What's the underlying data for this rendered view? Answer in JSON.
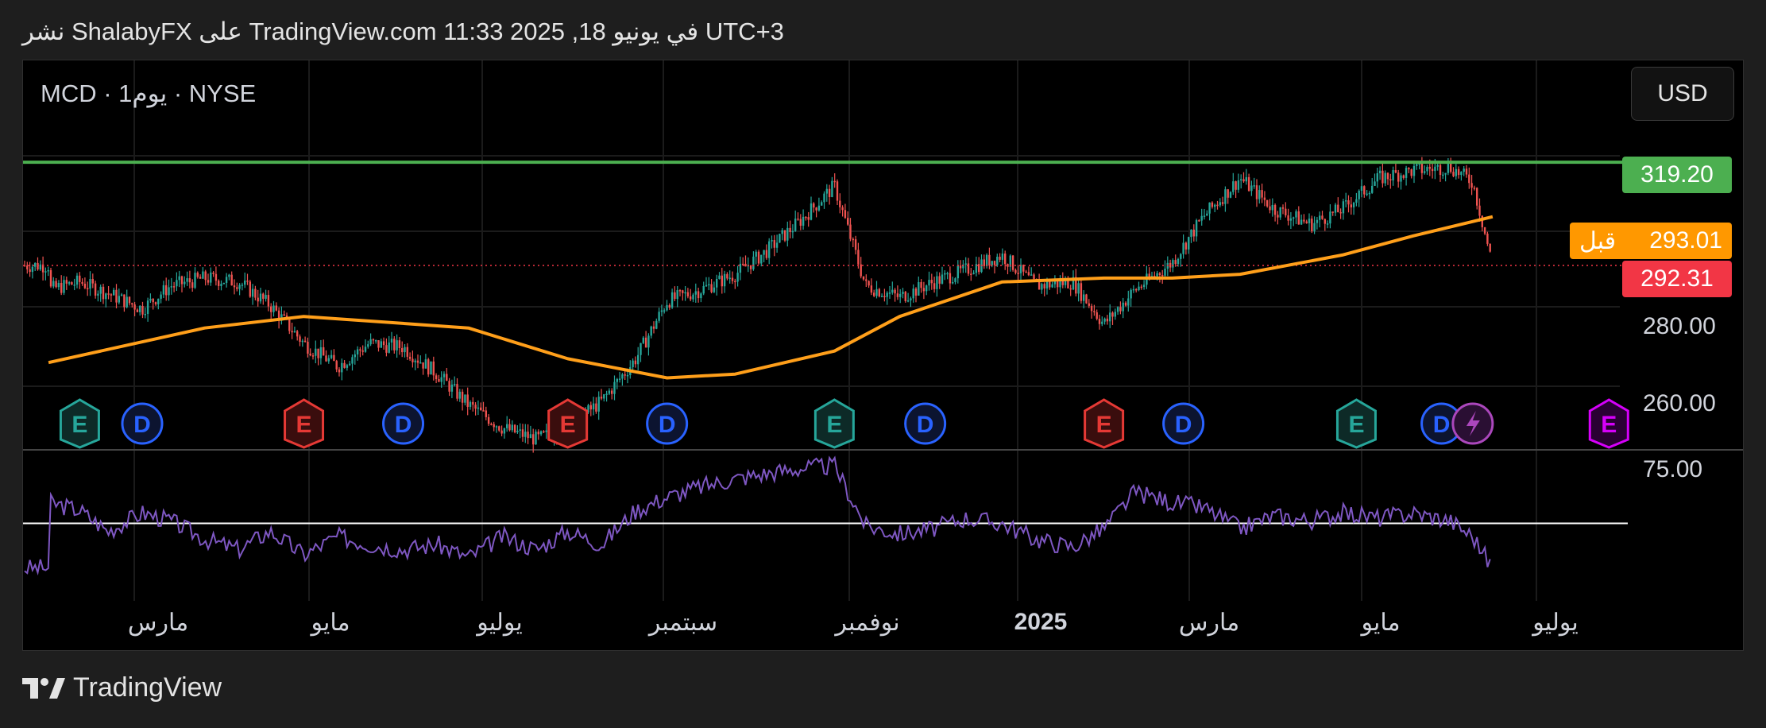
{
  "header": "نشر ShalabyFX على TradingView.com 11:33 2025 ,18 في يونيو UTC+3",
  "symbol_label": "MCD · 1يوم · NYSE",
  "currency_button": "USD",
  "price_tags": {
    "resistance": "319.20",
    "prev_label": "قبل",
    "prev_value": "293.01",
    "last_value": "292.31"
  },
  "colors": {
    "up": "#26a69a",
    "down": "#ef5350",
    "ma": "#ff9f1a",
    "resistance": "#4caf50",
    "last": "#f23645",
    "rsi": "#7e57c2"
  },
  "footer": {
    "logo_text": "TradingView"
  },
  "chart_data": {
    "type": "candlestick",
    "price_axis": {
      "ticks": [
        280,
        260
      ],
      "tick_labels": [
        "280.00",
        "260.00"
      ]
    },
    "x_axis_labels": [
      "مارس",
      "مايو",
      "يوليو",
      "سبتمبر",
      "نوفمبر",
      "2025",
      "مارس",
      "مايو",
      "يوليو"
    ],
    "horizontal_line": 319.2,
    "last_price": 292.31,
    "prev_close": 293.01,
    "price_series": {
      "x": [
        "2024-01-25",
        "2024-02-05",
        "2024-02-15",
        "2024-02-27",
        "2024-03-08",
        "2024-03-20",
        "2024-04-01",
        "2024-04-12",
        "2024-04-24",
        "2024-05-06",
        "2024-05-17",
        "2024-05-29",
        "2024-06-10",
        "2024-06-21",
        "2024-07-03",
        "2024-07-15",
        "2024-07-26",
        "2024-08-07",
        "2024-08-19",
        "2024-08-30",
        "2024-09-11",
        "2024-09-23",
        "2024-10-04",
        "2024-10-16",
        "2024-10-28",
        "2024-11-08",
        "2024-11-20",
        "2024-12-02",
        "2024-12-13",
        "2024-12-26",
        "2025-01-07",
        "2025-01-20",
        "2025-01-31",
        "2025-02-11",
        "2025-02-24",
        "2025-03-07",
        "2025-03-20",
        "2025-04-01",
        "2025-04-14",
        "2025-04-25",
        "2025-05-08",
        "2025-05-20",
        "2025-06-02",
        "2025-06-10",
        "2025-06-17"
      ],
      "close": [
        286,
        288,
        285,
        281,
        287,
        289,
        288,
        282,
        272,
        266,
        272,
        271,
        264,
        256,
        250,
        247,
        250,
        257,
        268,
        283,
        286,
        290,
        296,
        304,
        313,
        287,
        284,
        288,
        291,
        295,
        287,
        288,
        277,
        286,
        293,
        305,
        315,
        307,
        303,
        307,
        315,
        317,
        318,
        314,
        292.31
      ]
    },
    "moving_average": {
      "x": [
        "2024-01-25",
        "2024-03-20",
        "2024-04-24",
        "2024-06-21",
        "2024-07-26",
        "2024-08-30",
        "2024-09-23",
        "2024-10-28",
        "2024-11-20",
        "2024-12-26",
        "2025-01-31",
        "2025-02-24",
        "2025-03-20",
        "2025-04-25",
        "2025-05-20",
        "2025-06-17"
      ],
      "values": [
        267,
        276,
        279,
        276,
        268,
        263,
        264,
        270,
        279,
        288,
        289,
        289,
        290,
        295,
        300,
        305
      ]
    },
    "events": [
      {
        "type": "E",
        "x": "2024-02-05"
      },
      {
        "type": "D",
        "x": "2024-02-27"
      },
      {
        "type": "E",
        "x": "2024-04-24"
      },
      {
        "type": "D",
        "x": "2024-05-29"
      },
      {
        "type": "E",
        "x": "2024-07-26"
      },
      {
        "type": "D",
        "x": "2024-08-30"
      },
      {
        "type": "E",
        "x": "2024-10-28"
      },
      {
        "type": "D",
        "x": "2024-11-29"
      },
      {
        "type": "E",
        "x": "2025-01-31"
      },
      {
        "type": "D",
        "x": "2025-02-28"
      },
      {
        "type": "E",
        "x": "2025-04-30"
      },
      {
        "type": "D",
        "x": "2025-05-30"
      },
      {
        "type": "split",
        "x": "2025-06-10"
      },
      {
        "type": "E",
        "x": "2025-07-28"
      }
    ],
    "rsi": {
      "axis_label": "75.00",
      "reference_line": 50,
      "x": [
        "2024-01-25",
        "2024-02-05",
        "2024-02-15",
        "2024-02-27",
        "2024-03-08",
        "2024-03-20",
        "2024-04-01",
        "2024-04-12",
        "2024-04-24",
        "2024-05-06",
        "2024-05-17",
        "2024-05-29",
        "2024-06-10",
        "2024-06-21",
        "2024-07-03",
        "2024-07-15",
        "2024-07-26",
        "2024-08-07",
        "2024-08-19",
        "2024-08-30",
        "2024-09-11",
        "2024-09-23",
        "2024-10-04",
        "2024-10-16",
        "2024-10-28",
        "2024-11-08",
        "2024-11-20",
        "2024-12-02",
        "2024-12-13",
        "2024-12-26",
        "2025-01-07",
        "2025-01-20",
        "2025-01-31",
        "2025-02-11",
        "2025-02-24",
        "2025-03-07",
        "2025-03-20",
        "2025-04-01",
        "2025-04-14",
        "2025-04-25",
        "2025-05-08",
        "2025-05-20",
        "2025-06-02",
        "2025-06-10",
        "2025-06-17"
      ],
      "values": [
        58,
        55,
        47,
        54,
        51,
        44,
        40,
        47,
        38,
        45,
        42,
        40,
        42,
        37,
        45,
        40,
        47,
        42,
        55,
        60,
        64,
        67,
        69,
        71,
        72,
        49,
        46,
        48,
        52,
        50,
        44,
        41,
        48,
        62,
        58,
        56,
        48,
        53,
        51,
        54,
        52,
        54,
        51,
        45,
        33
      ]
    }
  }
}
